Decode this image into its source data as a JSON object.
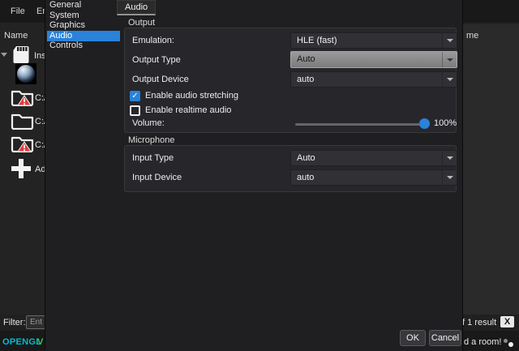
{
  "menu": {
    "items": [
      {
        "label": "File"
      },
      {
        "label": "Emulation"
      }
    ]
  },
  "game_list": {
    "header": "Name",
    "header_fragment": "me",
    "rows": [
      {
        "icon": "sd-card-icon",
        "label": "Ins"
      },
      {
        "icon": "game-orb-icon",
        "label": ""
      },
      {
        "icon": "folder-warning-icon",
        "label": "C:/"
      },
      {
        "icon": "folder-icon",
        "label": "C:/"
      },
      {
        "icon": "folder-warning-icon",
        "label": "C:/"
      },
      {
        "icon": "plus-icon",
        "label": "Ad"
      }
    ]
  },
  "filter_bar": {
    "label": "Filter:",
    "input_placeholder": "Ent",
    "results_text": "f 1 result",
    "close_icon": "X"
  },
  "status_bar": {
    "renderer": "OPENGL",
    "indicator": "V",
    "room_text": "d a room!"
  },
  "dialog": {
    "sidebar": {
      "items": [
        {
          "label": "General",
          "selected": false
        },
        {
          "label": "System",
          "selected": false
        },
        {
          "label": "Graphics",
          "selected": false
        },
        {
          "label": "Audio",
          "selected": true
        },
        {
          "label": "Controls",
          "selected": false
        }
      ]
    },
    "tab_label": "Audio",
    "output": {
      "title": "Output",
      "emulation": {
        "label": "Emulation:",
        "value": "HLE (fast)"
      },
      "output_type": {
        "label": "Output Type",
        "value": "Auto",
        "hovered": true
      },
      "output_device": {
        "label": "Output Device",
        "value": "auto"
      },
      "stretching": {
        "label": "Enable audio stretching",
        "checked": true,
        "check_glyph": "✓"
      },
      "realtime": {
        "label": "Enable realtime audio",
        "checked": false
      },
      "volume": {
        "label": "Volume:",
        "value": "100%",
        "percent": 100
      }
    },
    "microphone": {
      "title": "Microphone",
      "input_type": {
        "label": "Input Type",
        "value": "Auto"
      },
      "input_device": {
        "label": "Input Device",
        "value": "auto"
      }
    },
    "buttons": {
      "ok": "OK",
      "cancel": "Cancel"
    }
  },
  "colors": {
    "accent": "#2a82da",
    "renderer_text": "#00bcd4",
    "indicator_green": "#2ecc5a",
    "warning_red": "#e23b3b",
    "hovered_combo": "#8a8a8a"
  }
}
